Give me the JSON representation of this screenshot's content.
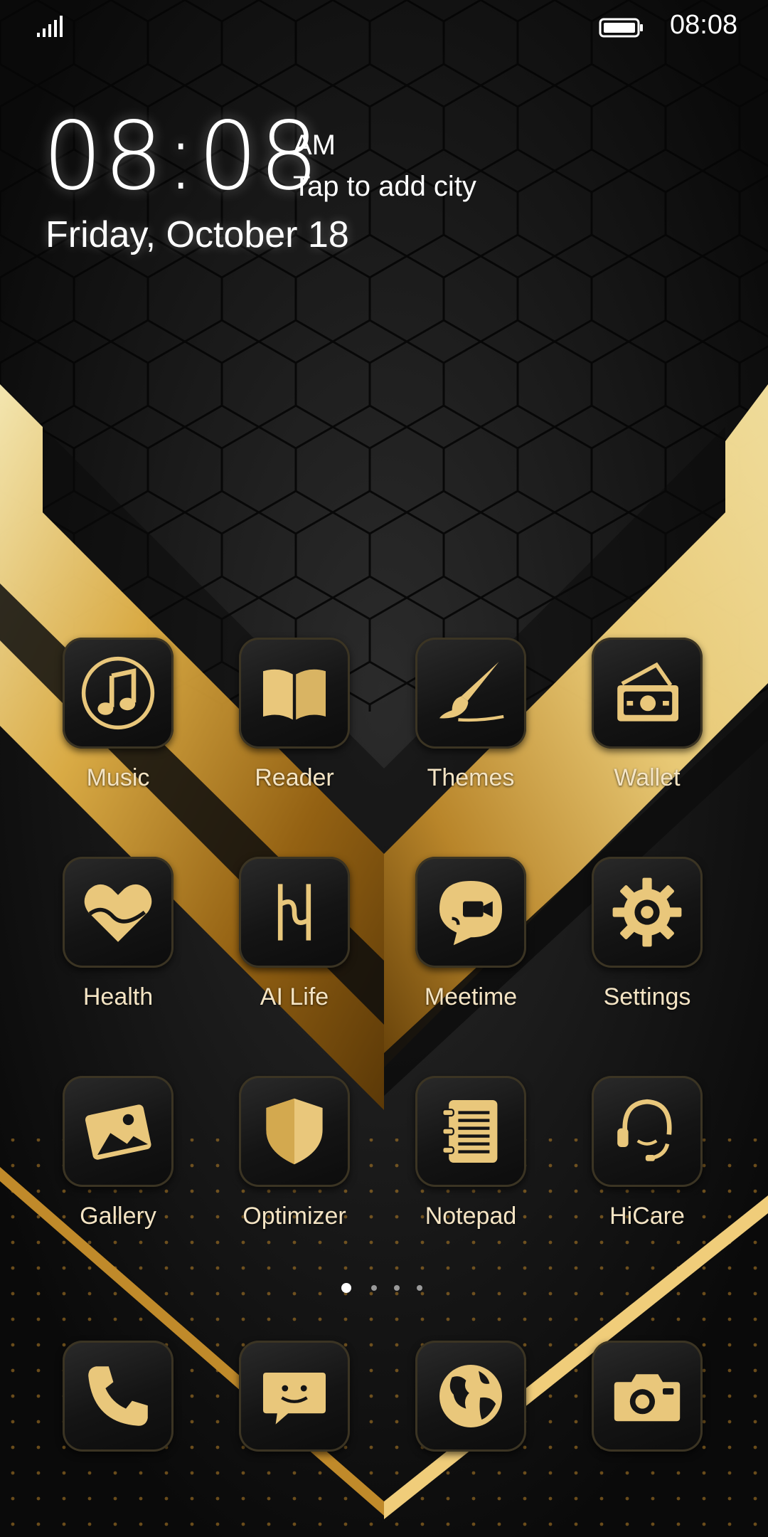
{
  "status_bar": {
    "time": "08:08"
  },
  "clock_widget": {
    "time": "08:08",
    "ampm": "AM",
    "city_prompt": "Tap to add city",
    "date": "Friday, October 18"
  },
  "apps": [
    {
      "label": "Music",
      "icon": "music-note-icon"
    },
    {
      "label": "Reader",
      "icon": "book-icon"
    },
    {
      "label": "Themes",
      "icon": "paintbrush-icon"
    },
    {
      "label": "Wallet",
      "icon": "wallet-cash-icon"
    },
    {
      "label": "Health",
      "icon": "heart-icon"
    },
    {
      "label": "AI Life",
      "icon": "ai-life-icon"
    },
    {
      "label": "Meetime",
      "icon": "video-chat-icon"
    },
    {
      "label": "Settings",
      "icon": "gear-icon"
    },
    {
      "label": "Gallery",
      "icon": "photo-icon"
    },
    {
      "label": "Optimizer",
      "icon": "shield-icon"
    },
    {
      "label": "Notepad",
      "icon": "notepad-icon"
    },
    {
      "label": "HiCare",
      "icon": "headset-icon"
    }
  ],
  "dock": [
    {
      "icon": "phone-icon"
    },
    {
      "icon": "message-icon"
    },
    {
      "icon": "globe-icon"
    },
    {
      "icon": "camera-icon"
    }
  ],
  "page_indicator": {
    "pages": 4,
    "active": 1
  },
  "colors": {
    "gold": "#e9c77b",
    "gold_dark": "#b8872a",
    "label": "#f4e4c4"
  }
}
